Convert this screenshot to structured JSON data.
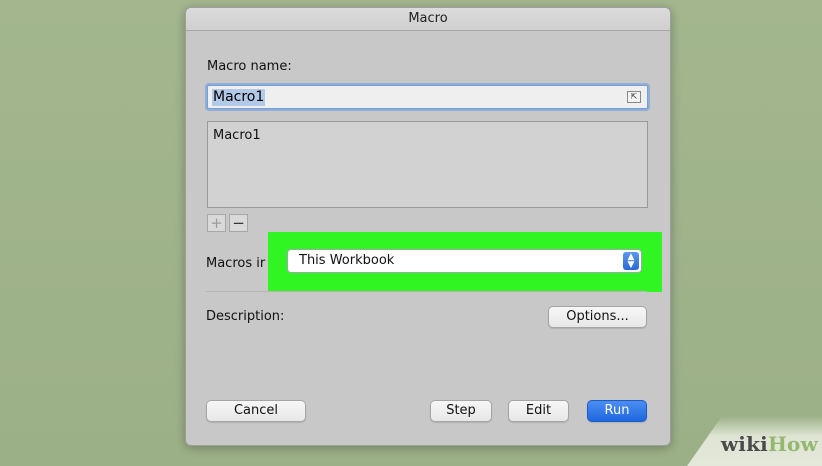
{
  "dialog": {
    "title": "Macro",
    "macro_name_label": "Macro name:",
    "macro_name_value": "Macro1",
    "macro_list": [
      "Macro1"
    ],
    "plus_icon": "plus-icon",
    "minus_icon": "minus-icon",
    "macros_in_label": "Macros in:",
    "macros_in_value": "This Workbook",
    "description_label": "Description:",
    "buttons": {
      "options": "Options...",
      "cancel": "Cancel",
      "step": "Step",
      "edit": "Edit",
      "run": "Run"
    }
  },
  "highlight_color": "#30f522",
  "accent_color": "#2a68d6",
  "watermark": {
    "wiki": "wiki",
    "how": "How"
  }
}
